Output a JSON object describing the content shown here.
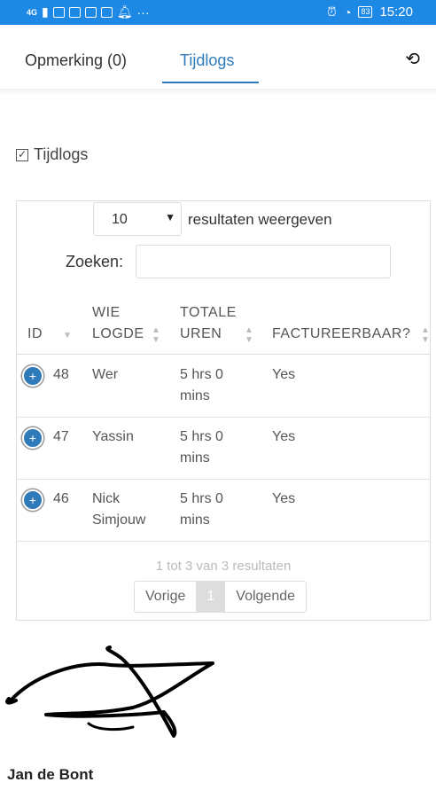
{
  "statusbar": {
    "signal_text": "4G",
    "battery": "83",
    "time": "15:20"
  },
  "tabs": [
    {
      "label": "Opmerking (0)",
      "active": false
    },
    {
      "label": "Tijdlogs",
      "active": true
    }
  ],
  "section": {
    "title": "Tijdlogs"
  },
  "table": {
    "length_value": "10",
    "length_label": "resultaten weergeven",
    "search_label": "Zoeken:",
    "search_value": "",
    "headers": {
      "id": "ID",
      "who": [
        "WIE",
        "LOGDE"
      ],
      "total": [
        "TOTALE",
        "UREN"
      ],
      "billable": "FACTUREERBAAR?"
    },
    "rows": [
      {
        "id": "48",
        "who": [
          "Wer"
        ],
        "total": [
          "5 hrs 0",
          "mins"
        ],
        "billable": "Yes"
      },
      {
        "id": "47",
        "who": [
          "Yassin"
        ],
        "total": [
          "5 hrs 0",
          "mins"
        ],
        "billable": "Yes"
      },
      {
        "id": "46",
        "who": [
          "Nick",
          "Simjouw"
        ],
        "total": [
          "5 hrs 0",
          "mins"
        ],
        "billable": "Yes"
      }
    ],
    "info": "1 tot 3 van 3 resultaten",
    "pagination": {
      "prev": "Vorige",
      "current": "1",
      "next": "Volgende"
    }
  },
  "signer_name": "Jan de Bont",
  "colors": {
    "accent": "#2f7ab8",
    "statusbar": "#1e88e5"
  }
}
